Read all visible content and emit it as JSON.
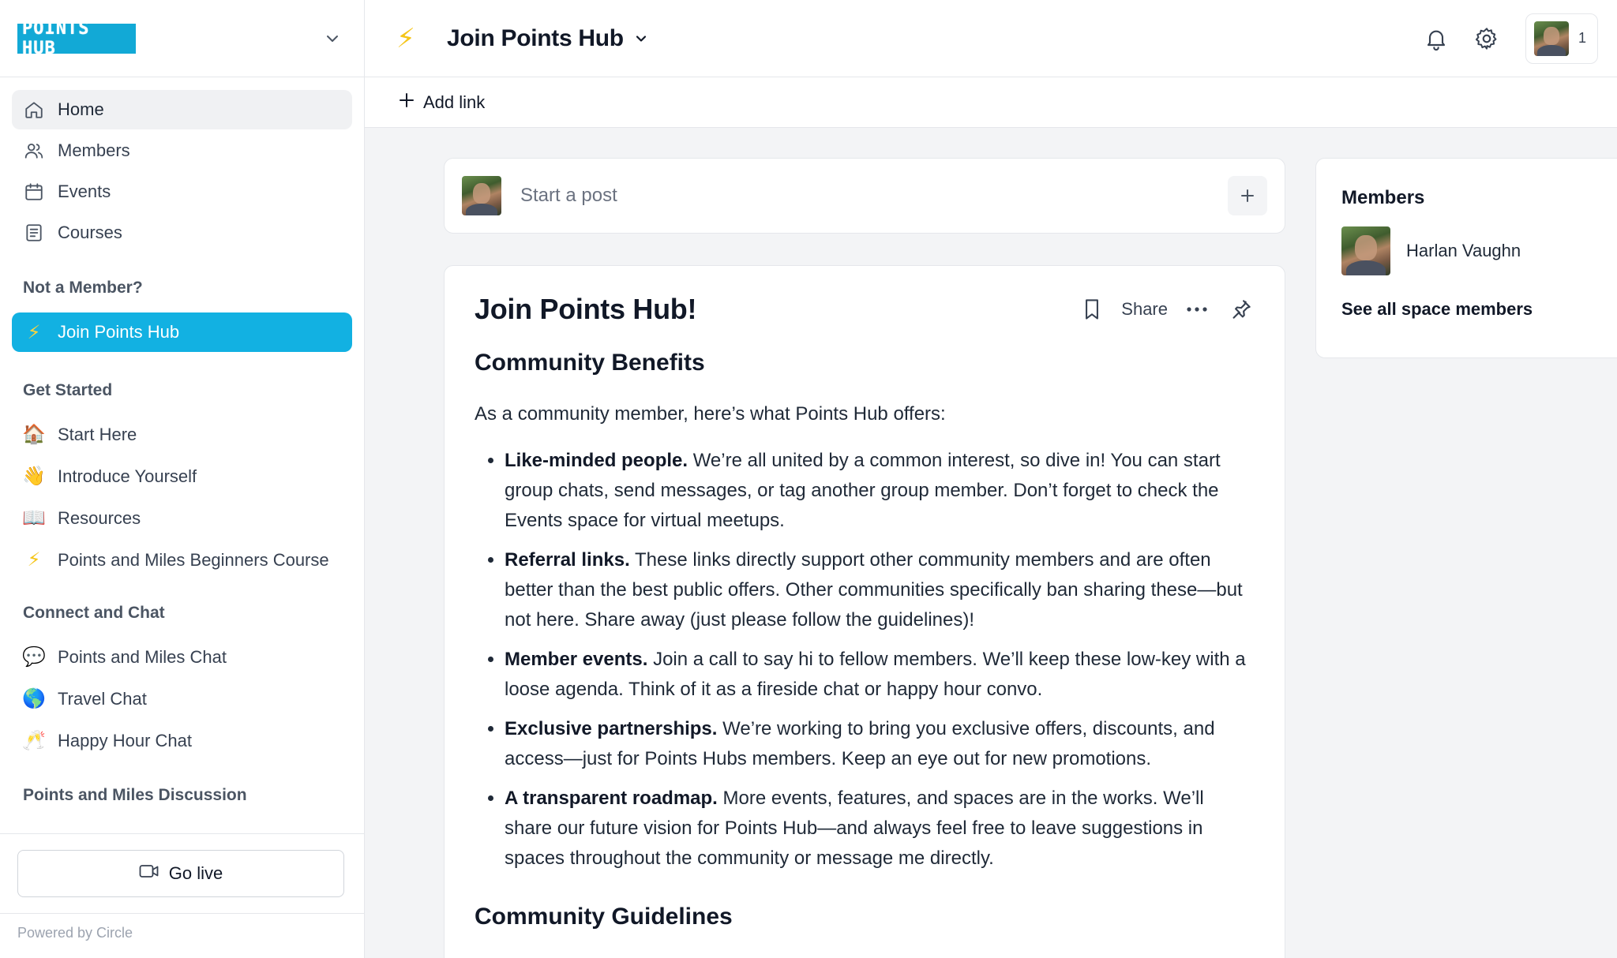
{
  "brand": {
    "logo_text": "POINTS HUB",
    "accent": "#12b1e2"
  },
  "sidebar": {
    "nav": [
      {
        "label": "Home",
        "icon": "home-icon"
      },
      {
        "label": "Members",
        "icon": "members-icon"
      },
      {
        "label": "Events",
        "icon": "calendar-icon"
      },
      {
        "label": "Courses",
        "icon": "courses-icon"
      }
    ],
    "sections": [
      {
        "title": "Not a Member?",
        "items": [
          {
            "label": "Join Points Hub",
            "emoji": "⚡"
          }
        ]
      },
      {
        "title": "Get Started",
        "items": [
          {
            "label": "Start Here",
            "emoji": "🏠"
          },
          {
            "label": "Introduce Yourself",
            "emoji": "👋"
          },
          {
            "label": "Resources",
            "emoji": "📖"
          },
          {
            "label": "Points and Miles Beginners Course",
            "emoji": "⚡"
          }
        ]
      },
      {
        "title": "Connect and Chat",
        "items": [
          {
            "label": "Points and Miles Chat",
            "emoji": "💬"
          },
          {
            "label": "Travel Chat",
            "emoji": "🌎"
          },
          {
            "label": "Happy Hour Chat",
            "emoji": "🥂"
          }
        ]
      },
      {
        "title": "Points and Miles Discussion",
        "items": []
      }
    ],
    "go_live_label": "Go live",
    "powered_by": "Powered by Circle"
  },
  "header": {
    "title": "Join Points Hub",
    "title_emoji": "⚡",
    "user_count": "1",
    "add_link_label": "Add link"
  },
  "composer": {
    "placeholder": "Start a post"
  },
  "post": {
    "title": "Join Points Hub!",
    "share_label": "Share",
    "section1_title": "Community Benefits",
    "intro": "As a community member, here’s what Points Hub offers:",
    "benefits": [
      {
        "bold": "Like-minded people.",
        "text": " We’re all united by a common interest, so dive in! You can start group chats, send messages, or tag another group member. Don’t forget to check the Events space for virtual meetups."
      },
      {
        "bold": "Referral links.",
        "text": " These links directly support other community members and are often better than the best public offers. Other communities specifically ban sharing these—but not here. Share away (just please follow the guidelines)!"
      },
      {
        "bold": "Member events.",
        "text": " Join a call to say hi to fellow members. We’ll keep these low-key with a loose agenda. Think of it as a fireside chat or happy hour convo."
      },
      {
        "bold": "Exclusive partnerships.",
        "text": " We’re working to bring you exclusive offers, discounts, and access—just for Points Hubs members. Keep an eye out for new promotions."
      },
      {
        "bold": "A transparent roadmap.",
        "text": " More events, features, and spaces are in the works. We’ll share our future vision for Points Hub—and always feel free to leave suggestions in spaces throughout the community or message me directly."
      }
    ],
    "section2_title": "Community Guidelines"
  },
  "members_panel": {
    "title": "Members",
    "members": [
      {
        "name": "Harlan Vaughn"
      }
    ],
    "see_all_label": "See all space members"
  }
}
